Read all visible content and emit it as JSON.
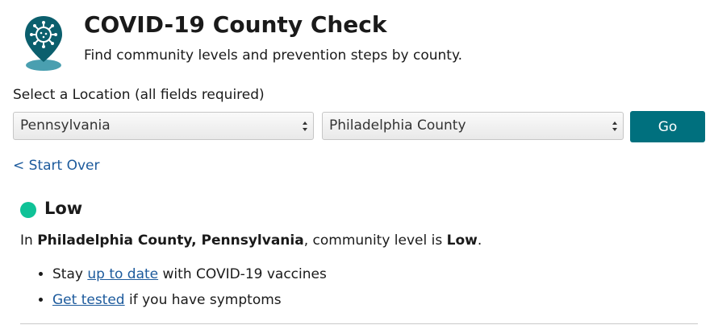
{
  "header": {
    "title": "COVID-19 County Check",
    "subtitle": "Find community levels and prevention steps by county.",
    "logo_icon": "map-pin-virus-icon"
  },
  "location_form": {
    "label": "Select a Location (all fields required)",
    "state_value": "Pennsylvania",
    "county_value": "Philadelphia County",
    "go_label": "Go",
    "start_over_label": "< Start Over"
  },
  "result": {
    "level": "Low",
    "level_color": "#0fc297",
    "statement_prefix": "In ",
    "county": "Philadelphia County, Pennsylvania",
    "statement_middle": ", community level is ",
    "statement_level": "Low",
    "statement_suffix": "."
  },
  "prevention_steps": [
    {
      "pre": "Stay ",
      "link": "up to date",
      "post": " with COVID-19 vaccines"
    },
    {
      "pre": "",
      "link": "Get tested",
      "post": " if you have symptoms"
    }
  ],
  "colors": {
    "accent": "#00707e",
    "link": "#1c5a9c"
  }
}
